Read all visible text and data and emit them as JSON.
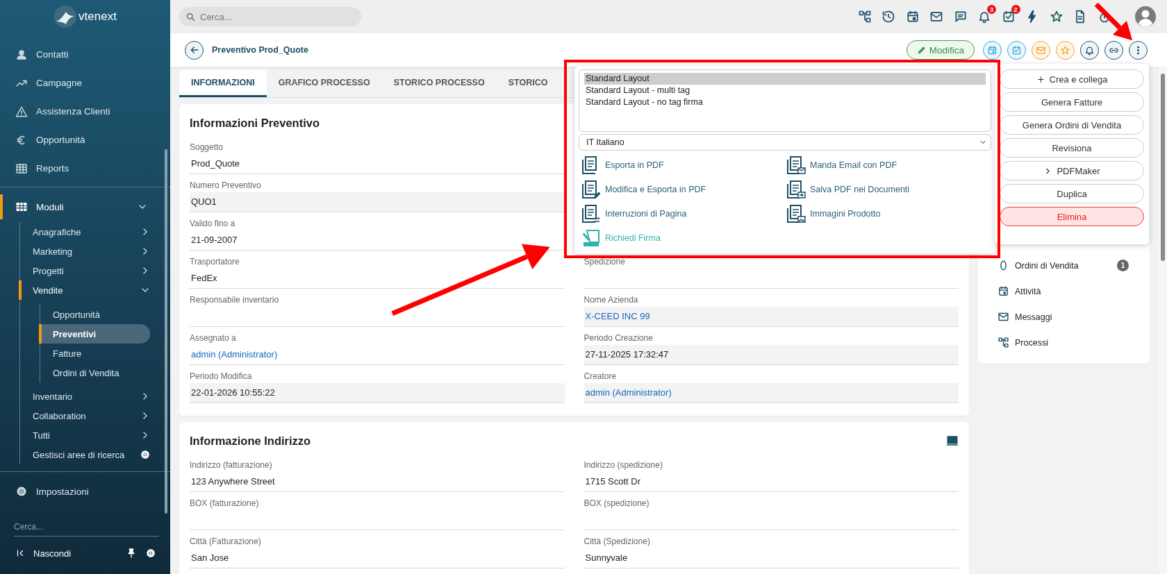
{
  "brand": {
    "name": "vtenext"
  },
  "sidebar": {
    "top_items": [
      {
        "label": "Contatti"
      },
      {
        "label": "Campagne"
      },
      {
        "label": "Assistenza Clienti"
      },
      {
        "label": "Opportunità"
      },
      {
        "label": "Reports"
      }
    ],
    "modules": {
      "label": "Moduli",
      "selected": true,
      "expanded": true,
      "children": [
        {
          "label": "Anagrafiche",
          "kind": "group",
          "expanded": false,
          "selected": false
        },
        {
          "label": "Marketing",
          "kind": "group",
          "expanded": false,
          "selected": false
        },
        {
          "label": "Progetti",
          "kind": "group",
          "expanded": false,
          "selected": false
        },
        {
          "label": "Vendite",
          "kind": "group",
          "expanded": true,
          "selected": true,
          "children": [
            {
              "label": "Opportunità",
              "selected": false
            },
            {
              "label": "Preventivi",
              "selected": true
            },
            {
              "label": "Fatture",
              "selected": false
            },
            {
              "label": "Ordini di Vendita",
              "selected": false
            }
          ]
        },
        {
          "label": "Inventario",
          "kind": "group",
          "expanded": false,
          "selected": false
        },
        {
          "label": "Collaboration",
          "kind": "group",
          "expanded": false,
          "selected": false
        },
        {
          "label": "Tutti",
          "kind": "group",
          "expanded": false,
          "selected": false
        },
        {
          "label": "Gestisci aree di ricerca",
          "kind": "settings",
          "selected": false
        }
      ]
    },
    "settings": {
      "label": "Impostazioni"
    },
    "search": {
      "placeholder": "Cerca..."
    },
    "footer": {
      "label": "Nascondi"
    }
  },
  "topbar": {
    "search": {
      "placeholder": "Cerca..."
    },
    "notification_badge": "3",
    "task_badge": "2"
  },
  "record": {
    "title": "Preventivo Prod_Quote",
    "edit_button": "Modifica"
  },
  "tabs": [
    {
      "label": "INFORMAZIONI",
      "selected": true
    },
    {
      "label": "GRAFICO PROCESSO",
      "selected": false
    },
    {
      "label": "STORICO PROCESSO",
      "selected": false
    },
    {
      "label": "STORICO",
      "selected": false
    }
  ],
  "sections": [
    {
      "title": "Informazioni Preventivo",
      "show_icon": false,
      "left": [
        {
          "label": "Soggetto",
          "value": "Prod_Quote",
          "readonly": false,
          "link": false
        },
        {
          "label": "Numero Preventivo",
          "value": "QUO1",
          "readonly": true,
          "link": false
        },
        {
          "label": "Valido fino a",
          "value": "21-09-2007",
          "readonly": false,
          "link": false
        },
        {
          "label": "Trasportatore",
          "value": "FedEx",
          "readonly": false,
          "link": false
        },
        {
          "label": "Responsabile inventario",
          "readonly": false
        },
        {
          "label": "Assegnato a",
          "value": "admin (Administrator)",
          "readonly": false,
          "link": true
        },
        {
          "label": "Periodo Modifica",
          "value": "22-01-2026 10:55:22",
          "readonly": true,
          "link": false
        }
      ],
      "right": [
        {
          "label": "Spedizione",
          "readonly": false
        },
        {
          "label": "Nome Azienda",
          "value": "X-CEED INC 99",
          "readonly": true,
          "link": true
        },
        {
          "label": "Periodo Creazione",
          "value": "27-11-2025 17:32:47",
          "readonly": true,
          "link": false
        },
        {
          "label": "Creatore",
          "value": "admin (Administrator)",
          "readonly": true,
          "link": true
        }
      ]
    },
    {
      "title": "Informazione Indirizzo",
      "show_icon": true,
      "left": [
        {
          "label": "Indirizzo (fatturazione)",
          "value": "123 Anywhere Street",
          "readonly": false,
          "link": false
        },
        {
          "label": "BOX (fatturazione)",
          "readonly": false
        },
        {
          "label": "Città (Fatturazione)",
          "value": "San Jose",
          "readonly": false,
          "link": false
        }
      ],
      "right": [
        {
          "label": "Indirizzo (spedizione)",
          "value": "1715 Scott Dr",
          "readonly": false,
          "link": false
        },
        {
          "label": "BOX (spedizione)",
          "readonly": false
        },
        {
          "label": "Città (Spedizione)",
          "value": "Sunnyvale",
          "readonly": false,
          "link": false
        }
      ]
    }
  ],
  "related": [
    {
      "label": "Ordini di Vendita",
      "count": "1"
    },
    {
      "label": "Attività"
    },
    {
      "label": "Messaggi"
    },
    {
      "label": "Processi"
    }
  ],
  "pdf_menu": {
    "layouts": [
      {
        "label": "Standard Layout",
        "selected": true
      },
      {
        "label": "Standard Layout - multi tag",
        "selected": false
      },
      {
        "label": "Standard Layout - no tag firma",
        "selected": false
      }
    ],
    "language": "IT Italiano",
    "actions": [
      {
        "label": "Esporta in PDF",
        "kind": "pdf"
      },
      {
        "label": "Manda Email con PDF",
        "kind": "pdf"
      },
      {
        "label": "Modifica e Esporta in PDF",
        "kind": "pdf"
      },
      {
        "label": "Salva PDF nei Documenti",
        "kind": "pdf"
      },
      {
        "label": "Interruzioni di Pagina",
        "kind": "pdf"
      },
      {
        "label": "Immagini Prodotto",
        "kind": "pdf"
      },
      {
        "label": "Richiedi Firma",
        "kind": "signature"
      }
    ]
  },
  "actions_menu": [
    {
      "label": "Crea e collega",
      "kind": "create"
    },
    {
      "label": "Genera Fatture",
      "kind": "plain"
    },
    {
      "label": "Genera Ordini di Vendita",
      "kind": "plain"
    },
    {
      "label": "Revisiona",
      "kind": "plain"
    },
    {
      "label": "PDFMaker",
      "kind": "submenu"
    },
    {
      "label": "Duplica",
      "kind": "plain"
    },
    {
      "label": "Elimina",
      "kind": "danger"
    }
  ],
  "annotations": [
    {
      "kind": "frame"
    },
    {
      "kind": "arrow"
    },
    {
      "kind": "arrow"
    }
  ]
}
